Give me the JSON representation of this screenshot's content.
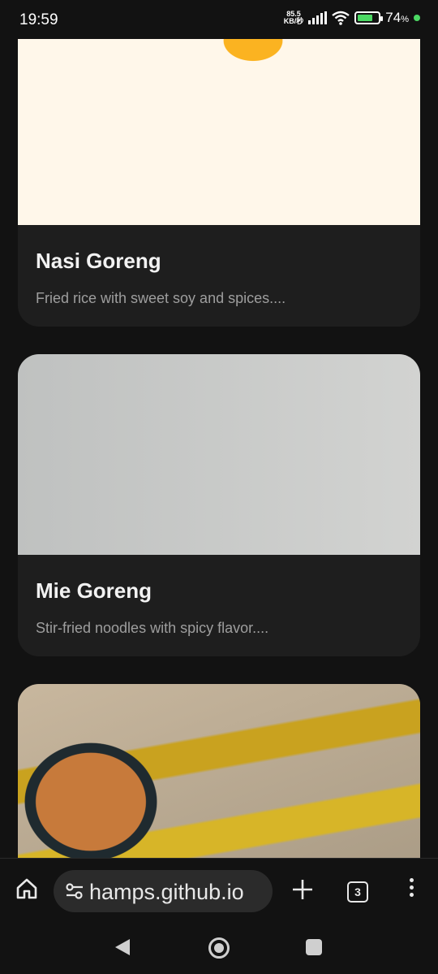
{
  "status_bar": {
    "time": "19:59",
    "net_speed_value": "85.5",
    "net_speed_unit": "KB/秒",
    "battery_percent": "74",
    "battery_unit": "%"
  },
  "cards": [
    {
      "title": "Nasi Goreng",
      "description": "Fried rice with sweet soy and spices...."
    },
    {
      "title": "Mie Goreng",
      "description": "Stir-fried noodles with spicy flavor...."
    },
    {
      "title": "",
      "description": ""
    }
  ],
  "browser": {
    "url": "hamps.github.io",
    "tab_count": "3",
    "icons": [
      "home-icon",
      "site-settings-icon",
      "plus-icon",
      "tab-switcher-icon",
      "more-vert-icon"
    ]
  },
  "system_nav": {
    "icons": [
      "back-icon",
      "home-circle-icon",
      "recents-icon"
    ]
  },
  "colors": {
    "background": "#121212",
    "card": "#1e1e1e",
    "battery_green": "#4cd964"
  }
}
